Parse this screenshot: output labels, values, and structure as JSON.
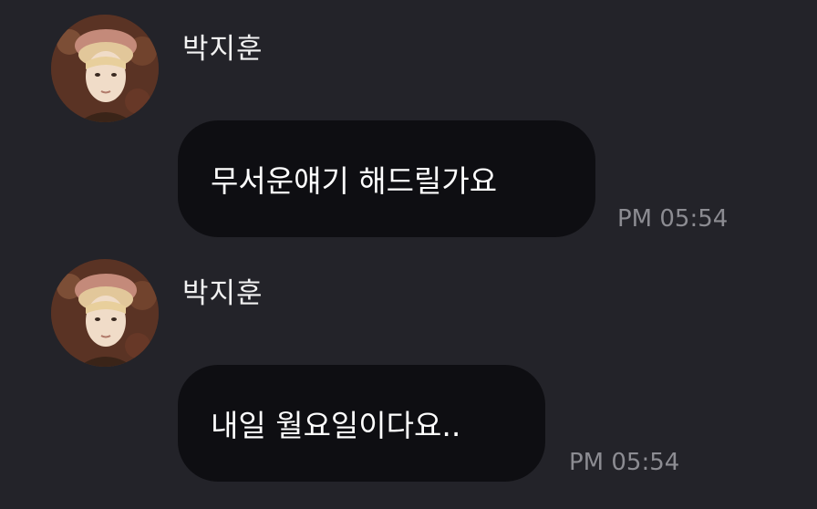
{
  "messages": [
    {
      "sender": "박지훈",
      "text": "무서운얘기 해드릴가요",
      "time": "PM 05:54"
    },
    {
      "sender": "박지훈",
      "text": "내일 월요일이다요..",
      "time": "PM 05:54"
    }
  ],
  "colors": {
    "background": "#232329",
    "bubble": "#0e0e12",
    "text": "#ffffff",
    "timestamp": "#8c8c92"
  }
}
